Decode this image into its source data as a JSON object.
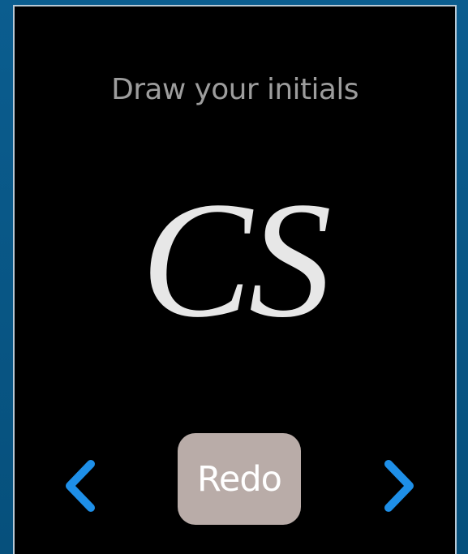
{
  "screen": {
    "prompt": "Draw your initials",
    "initials": "CS"
  },
  "controls": {
    "redo_label": "Redo",
    "prev_icon": "chevron-left-icon",
    "next_icon": "chevron-right-icon"
  },
  "colors": {
    "background": "#000000",
    "prompt_text": "#9d9d9d",
    "initials_text": "#e7e7e7",
    "redo_button": "#b9aca8",
    "arrow": "#1e8fe8",
    "outer_frame": "#07588a"
  }
}
